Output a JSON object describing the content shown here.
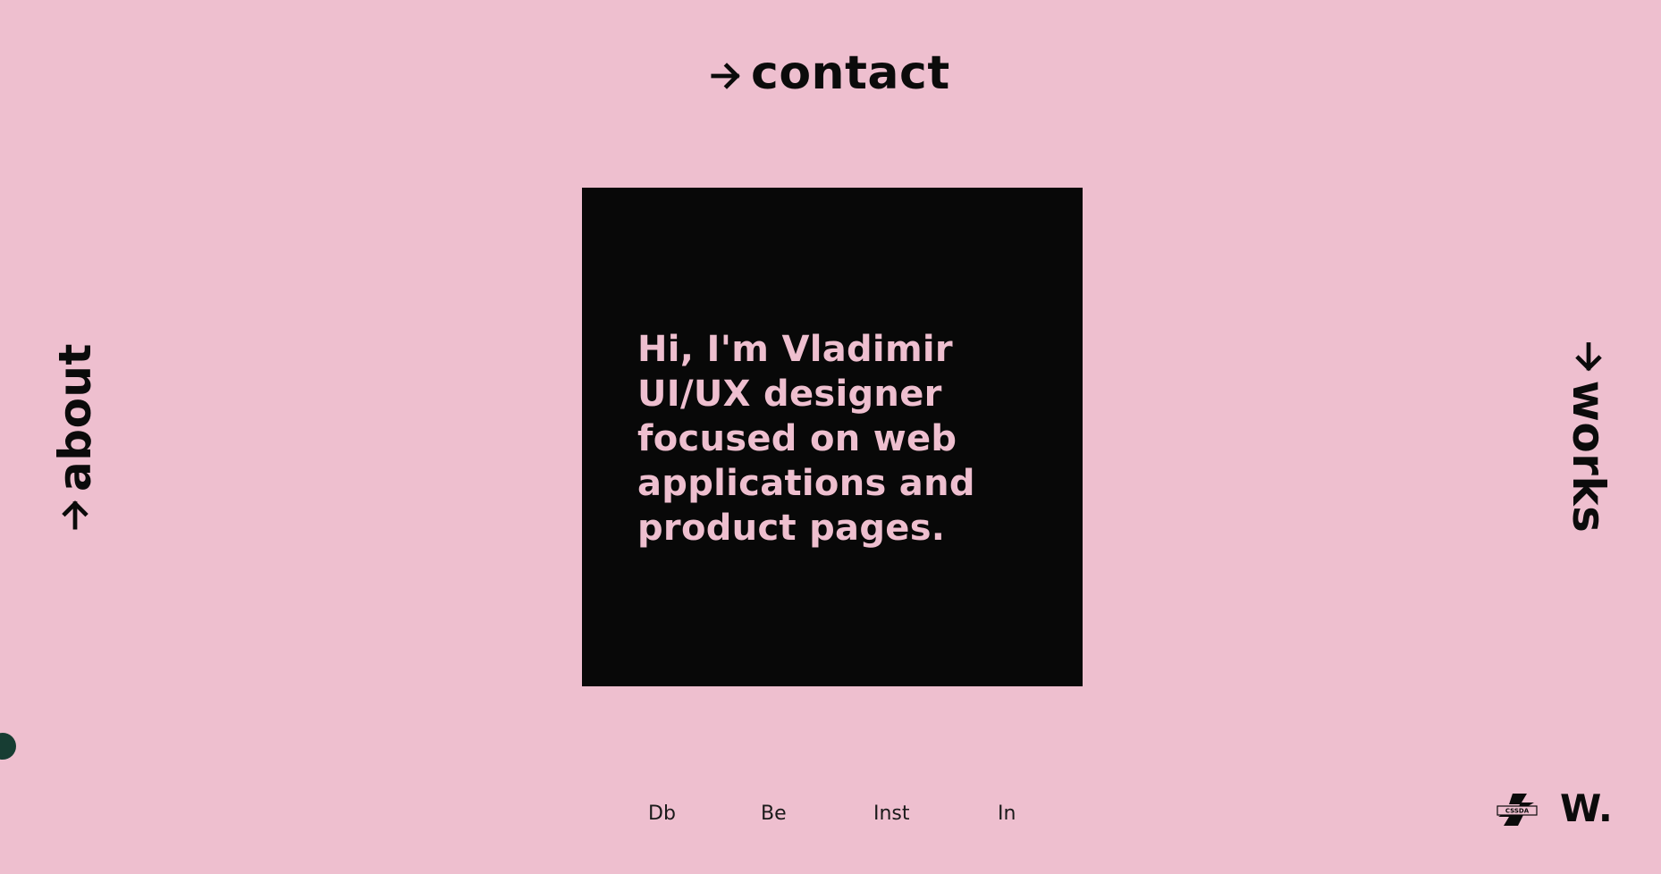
{
  "nav": {
    "contact": "contact",
    "about": "about",
    "works": "works"
  },
  "hero": {
    "lines": [
      "Hi, I'm Vladimir",
      "UI/UX designer",
      "focused on web",
      "applications and",
      "product pages."
    ]
  },
  "socials": [
    "Db",
    "Be",
    "Inst",
    "In"
  ],
  "footer": {
    "badge_text": "CSSDA",
    "logo": "W."
  },
  "colors": {
    "background": "#eebfcf",
    "panel": "#080808",
    "accent_dot": "#173d33",
    "text": "#0b0b0b"
  },
  "icons": {
    "nav_arrow": "arrow-right-icon",
    "award_badge": "cssda-badge-icon"
  }
}
